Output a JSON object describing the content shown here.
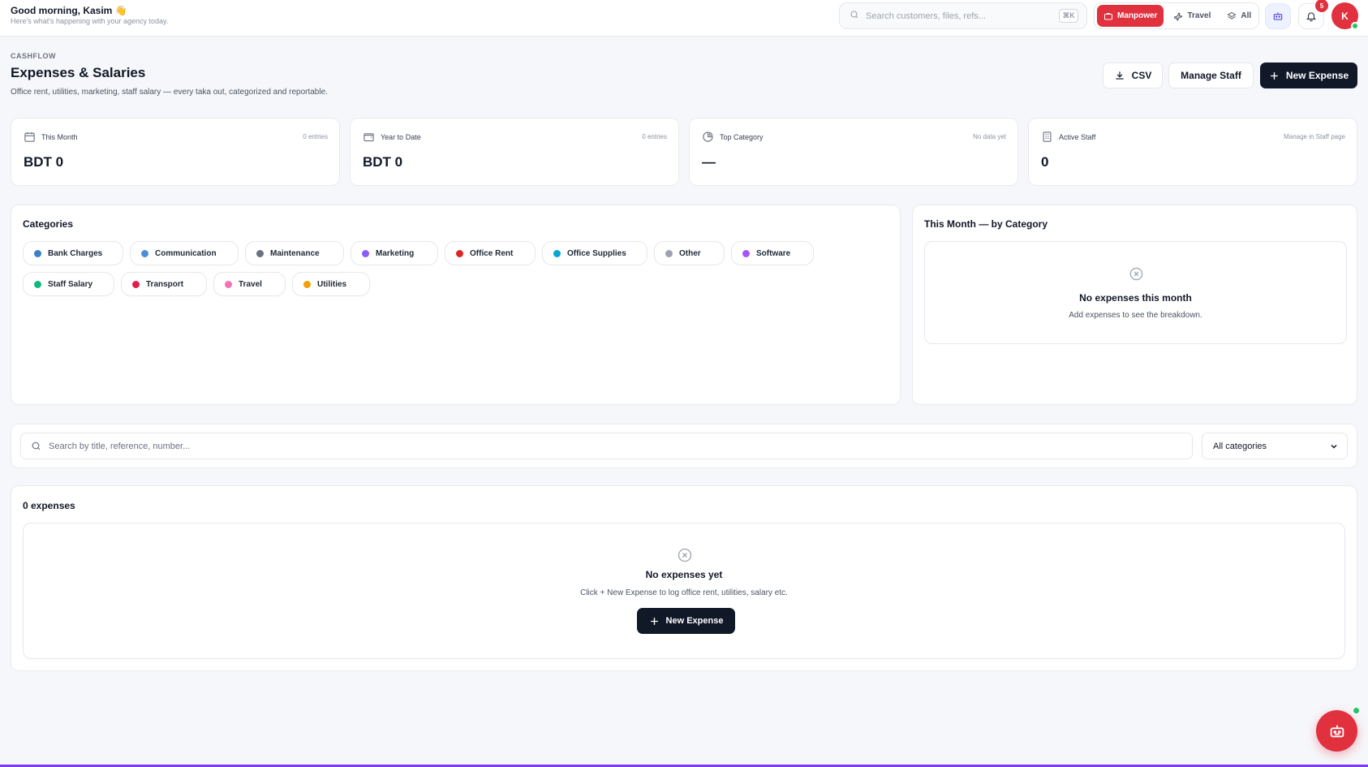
{
  "header": {
    "greeting": "Good morning, Kasim 👋",
    "subtitle": "Here's what's happening with your agency today.",
    "search_placeholder": "Search customers, files, refs...",
    "shortcut": "⌘K",
    "modes": [
      {
        "label": "Manpower",
        "active": true
      },
      {
        "label": "Travel",
        "active": false
      },
      {
        "label": "All",
        "active": false
      }
    ],
    "notification_count": "5",
    "avatar_initial": "K"
  },
  "page": {
    "eyebrow": "CASHFLOW",
    "title": "Expenses & Salaries",
    "subtitle": "Office rent, utilities, marketing, staff salary — every taka out, categorized and reportable.",
    "csv_label": "CSV",
    "manage_staff_label": "Manage Staff",
    "new_expense_label": "New Expense"
  },
  "stats": [
    {
      "label": "This Month",
      "meta": "0 entries",
      "value": "BDT 0",
      "icon": "calendar-icon"
    },
    {
      "label": "Year to Date",
      "meta": "0 entries",
      "value": "BDT 0",
      "icon": "wallet-icon"
    },
    {
      "label": "Top Category",
      "meta": "No data yet",
      "value": "—",
      "icon": "pie-chart-icon"
    },
    {
      "label": "Active Staff",
      "meta": "Manage in Staff page",
      "value": "0",
      "icon": "building-icon"
    }
  ],
  "categories": {
    "title": "Categories",
    "items": [
      {
        "label": "Bank Charges",
        "color": "#3b82c4"
      },
      {
        "label": "Communication",
        "color": "#4a90d9"
      },
      {
        "label": "Maintenance",
        "color": "#6b7280"
      },
      {
        "label": "Marketing",
        "color": "#8b5cf6"
      },
      {
        "label": "Office Rent",
        "color": "#dc2626"
      },
      {
        "label": "Office Supplies",
        "color": "#06a6d4"
      },
      {
        "label": "Other",
        "color": "#9ca3af"
      },
      {
        "label": "Software",
        "color": "#a855f7"
      },
      {
        "label": "Staff Salary",
        "color": "#10b981"
      },
      {
        "label": "Transport",
        "color": "#e11d48"
      },
      {
        "label": "Travel",
        "color": "#f472b6"
      },
      {
        "label": "Utilities",
        "color": "#f59e0b"
      }
    ]
  },
  "by_category": {
    "title": "This Month — by Category",
    "empty_title": "No expenses this month",
    "empty_sub": "Add expenses to see the breakdown."
  },
  "filter": {
    "search_placeholder": "Search by title, reference, number...",
    "category_selected": "All categories"
  },
  "expenses": {
    "count_label": "0 expenses",
    "empty_title": "No expenses yet",
    "empty_sub": "Click + New Expense to log office rent, utilities, salary etc.",
    "cta_label": "New Expense"
  }
}
